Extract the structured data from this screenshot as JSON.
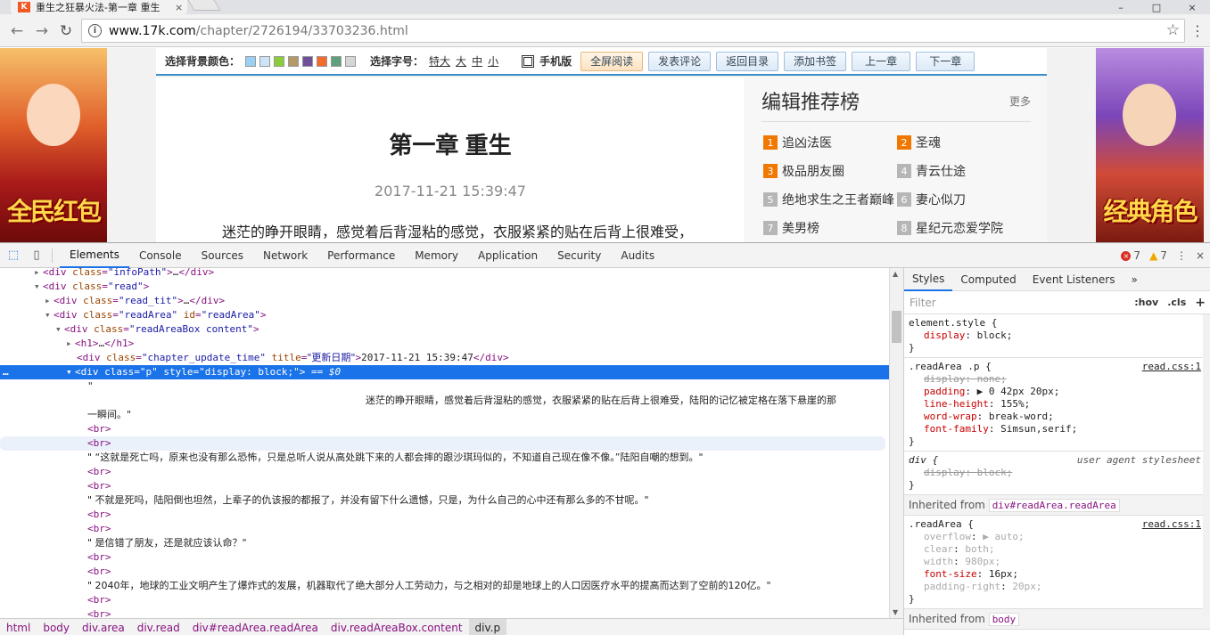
{
  "browser": {
    "tab_title": "重生之狂暴火法-第一章 重生",
    "tab_favicon": "K",
    "tab_close": "×",
    "url_host": "www.17k.com",
    "url_path": "/chapter/2726194/33703236.html",
    "window_controls": [
      "–",
      "□",
      "×"
    ]
  },
  "page": {
    "toolbar": {
      "bg_label": "选择背景颜色：",
      "bg_colors": [
        "#9ad0f5",
        "#cce4fa",
        "#8ccc3a",
        "#b59968",
        "#6f4f98",
        "#f26a2c",
        "#5fa07c",
        "#d6d6d6"
      ],
      "font_label": "选择字号：",
      "font_sizes": [
        "特大",
        "大",
        "中",
        "小"
      ],
      "mobile_label": "手机版",
      "buttons": [
        "全屏阅读",
        "发表评论",
        "返回目录",
        "添加书签",
        "上一章",
        "下一章"
      ]
    },
    "chapter": {
      "title": "第一章 重生",
      "time": "2017-11-21 15:39:47",
      "first_para": "迷茫的睁开眼睛，感觉着后背湿粘的感觉，衣服紧紧的贴在后背上很难受，"
    },
    "recommend": {
      "title": "编辑推荐榜",
      "more": "更多",
      "items": [
        {
          "rank": "1",
          "name": "追凶法医"
        },
        {
          "rank": "2",
          "name": "圣魂"
        },
        {
          "rank": "3",
          "name": "极品朋友圈"
        },
        {
          "rank": "4",
          "name": "青云仕途"
        },
        {
          "rank": "5",
          "name": "绝地求生之王者巅峰"
        },
        {
          "rank": "6",
          "name": "妻心似刀"
        },
        {
          "rank": "7",
          "name": "美男榜"
        },
        {
          "rank": "8",
          "name": "星纪元恋爱学院"
        }
      ]
    },
    "ads": {
      "left_text": "全民红包",
      "right_text": "经典角色"
    }
  },
  "devtools": {
    "tabs": [
      "Elements",
      "Console",
      "Sources",
      "Network",
      "Performance",
      "Memory",
      "Application",
      "Security",
      "Audits"
    ],
    "error_count": "7",
    "warning_count": "7",
    "more": "⋮",
    "close": "×",
    "elements": {
      "line1_attr_val": "\"infoPath\"",
      "line2_attr_val": "\"read\"",
      "line3_attr_val": "\"read_tit\"",
      "line4_attr_val": "\"readArea\"",
      "line4_id_val": "\"readArea\"",
      "line5_attr_val": "\"readAreaBox content\"",
      "line7_class_val": "\"chapter_update_time\"",
      "line7_title_val": "\"更新日期\"",
      "line7_text": "2017-11-21 15:39:47",
      "line8_class_val": "\"p\"",
      "line8_style_val": "\"display: block;\"",
      "line8_suffix": "== $0",
      "p1a": "迷茫的睁开眼睛，感觉着后背湿粘的感觉，衣服紧紧的贴在后背上很难受，陆阳的记忆被定格在落下悬崖的那",
      "p1b": "一瞬间。\"",
      "p2": "\"    “这就是死亡吗，原来也没有那么恐怖，只是总听人说从高处跳下来的人都会摔的跟沙琪玛似的，不知道自己现在像不像。”陆阳自嘲的想到。\"",
      "p3": "\"    不就是死吗，陆阳倒也坦然，上辈子的仇该报的都报了，并没有留下什么遗憾，只是，为什么自己的心中还有那么多的不甘呢。\"",
      "p4": "\"    是信错了朋友，还是就应该认命？\"",
      "p5": "\"    2040年，地球的工业文明产生了爆炸式的发展，机器取代了绝大部分人工劳动力，与之相对的却是地球上的人口因医疗水平的提高而达到了空前的120亿。\"",
      "br": "<br>",
      "quote": "\""
    },
    "breadcrumbs": [
      "html",
      "body",
      "div.area",
      "div.read",
      "div#readArea.readArea",
      "div.readAreaBox.content",
      "div.p"
    ],
    "styles": {
      "tabs": [
        "Styles",
        "Computed",
        "Event Listeners",
        "»"
      ],
      "filter_placeholder": "Filter",
      "hov": ":hov",
      "cls": ".cls",
      "add": "+",
      "element_style_sel": "element.style {",
      "es_prop": "display",
      "es_val": "block;",
      "rule1_sel": ".readArea .p {",
      "rule1_src": "read.css:1",
      "rule1_props": [
        {
          "n": "display",
          "v": "none;",
          "struck": true
        },
        {
          "n": "padding",
          "v": "▶ 0 42px 20px;",
          "struck": false
        },
        {
          "n": "line-height",
          "v": "155%;",
          "struck": false
        },
        {
          "n": "word-wrap",
          "v": "break-word;",
          "struck": false
        },
        {
          "n": "font-family",
          "v": "Simsun,serif;",
          "struck": false
        }
      ],
      "rule2_sel": "div {",
      "rule2_src": "user agent stylesheet",
      "rule2_prop": "display",
      "rule2_val": "block;",
      "inherited_label": "Inherited from",
      "inherited_tag": "div#readArea.readArea",
      "rule3_sel": ".readArea {",
      "rule3_src": "read.css:1",
      "rule3_props": [
        {
          "n": "overflow",
          "v": "▶ auto;",
          "dim": true
        },
        {
          "n": "clear",
          "v": "both;",
          "dim": true
        },
        {
          "n": "width",
          "v": "980px;",
          "dim": true
        },
        {
          "n": "font-size",
          "v": "16px;",
          "dim": false
        },
        {
          "n": "padding-right",
          "v": "20px;",
          "dim": true
        }
      ],
      "inherited2_label": "Inherited from",
      "inherited2_tag": "body",
      "close_brace": "}"
    }
  }
}
